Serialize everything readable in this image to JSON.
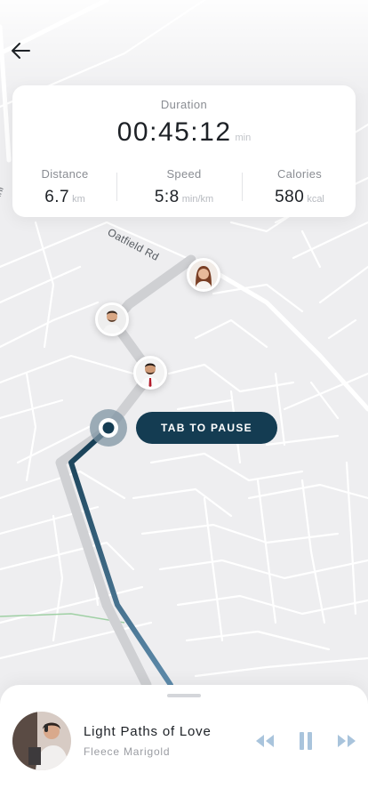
{
  "stats": {
    "duration_label": "Duration",
    "duration_value": "00:45:12",
    "duration_unit": "min",
    "distance_label": "Distance",
    "distance_value": "6.7",
    "distance_unit": "km",
    "speed_label": "Speed",
    "speed_value": "5:8",
    "speed_unit": "min/km",
    "calories_label": "Calories",
    "calories_value": "580",
    "calories_unit": "kcal"
  },
  "map": {
    "street_label": "Oatfield Rd",
    "edge_label": "enni"
  },
  "actions": {
    "pause_label": "TAB TO PAUSE"
  },
  "player": {
    "track_title": "Light Paths of Love",
    "track_artist": "Fleece Marigold"
  },
  "colors": {
    "accent": "#143c52",
    "route_active": "#2f5f7c",
    "route_planned": "#cfd0d3",
    "controls": "#a9c4dc"
  },
  "icons": {
    "back": "arrow-left-icon",
    "rewind": "rewind-icon",
    "pause": "pause-icon",
    "forward": "fast-forward-icon",
    "position": "current-location-icon"
  }
}
